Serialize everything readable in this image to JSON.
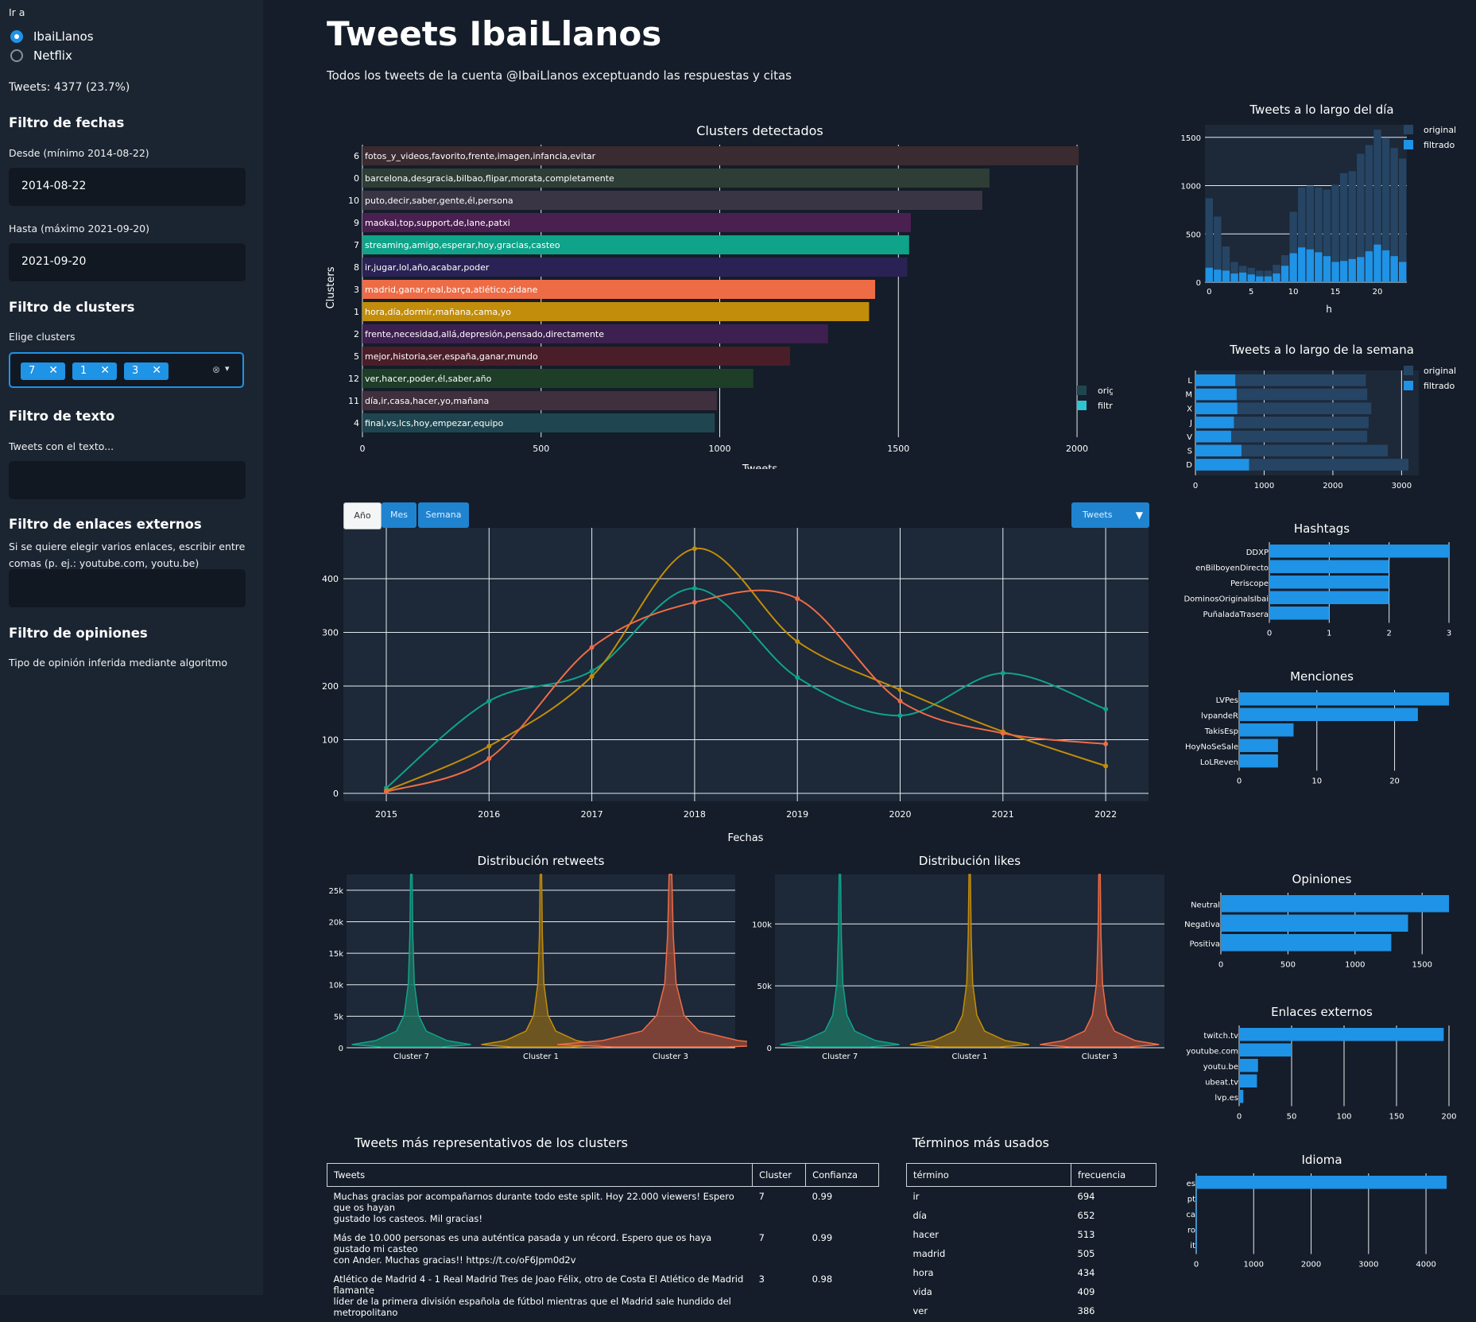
{
  "sidebar": {
    "goto_label": "Ir a",
    "options": [
      "IbaiLlanos",
      "Netflix"
    ],
    "tweets_count": "Tweets: 4377 (23.7%)",
    "date_filter": {
      "title": "Filtro de fechas",
      "from_label": "Desde (mínimo 2014-08-22)",
      "from_value": "2014-08-22",
      "to_label": "Hasta (máximo 2021-09-20)",
      "to_value": "2021-09-20"
    },
    "cluster_filter": {
      "title": "Filtro de clusters",
      "label": "Elige clusters",
      "chips": [
        "7",
        "1",
        "3"
      ]
    },
    "text_filter": {
      "title": "Filtro de texto",
      "label": "Tweets con el texto..."
    },
    "links_filter": {
      "title": "Filtro de enlaces externos",
      "desc1": "Si se quiere elegir varios enlaces, escribir entre",
      "desc2": "comas (p. ej.: youtube.com, youtu.be)"
    },
    "opinion_filter": {
      "title": "Filtro de opiniones",
      "label": "Tipo de opinión inferida mediante algoritmo"
    }
  },
  "main": {
    "title": "Tweets IbaiLlanos",
    "subtitle": "Todos los tweets de la cuenta @IbaiLlanos exceptuando las respuestas y citas"
  },
  "time_buttons": [
    "Año",
    "Mes",
    "Semana"
  ],
  "metric_dropdown": "Tweets",
  "colors": {
    "accent": "#1f93e6",
    "cluster7": "#0fa38a",
    "cluster1": "#c28d0a",
    "cluster3": "#ed6c45",
    "bg": "#141d29",
    "sidebar": "#1b2532"
  },
  "tables": {
    "tweets": {
      "title": "Tweets más representativos de los clusters",
      "headers": [
        "Tweets",
        "Cluster",
        "Confianza"
      ],
      "rows": [
        {
          "l1": "Muchas gracias por acompañarnos durante todo este split. Hoy 22.000 viewers! Espero que os hayan",
          "l2": "gustado los casteos. Mil gracias!",
          "cluster": "7",
          "conf": "0.99"
        },
        {
          "l1": "Más de 10.000 personas es una auténtica pasada y un récord. Espero que os haya gustado mi casteo",
          "l2": "con Ander. Muchas gracias!! https://t.co/oF6Jpm0d2v",
          "cluster": "7",
          "conf": "0.99"
        },
        {
          "l1": "Atlético de Madrid 4 - 1 Real Madrid   Tres de Joao Félix, otro de Costa   El Atlético de Madrid flamante",
          "l2": "líder de la primera división española de fútbol mientras que el Madrid sale hundido del metropolitano",
          "cluster": "3",
          "conf": "0.98"
        }
      ]
    },
    "terms": {
      "title": "Términos más usados",
      "headers": [
        "término",
        "frecuencia"
      ],
      "rows": [
        [
          "ir",
          "694"
        ],
        [
          "día",
          "652"
        ],
        [
          "hacer",
          "513"
        ],
        [
          "madrid",
          "505"
        ],
        [
          "hora",
          "434"
        ],
        [
          "vida",
          "409"
        ],
        [
          "ver",
          "386"
        ]
      ]
    }
  },
  "chart_data": [
    {
      "type": "bar",
      "title": "Clusters detectados",
      "xlabel": "Tweets",
      "ylabel": "Clusters",
      "orientation": "horizontal",
      "xlim": [
        0,
        2100
      ],
      "xticks": [
        0,
        500,
        1000,
        1500,
        2000
      ],
      "legend": [
        "original",
        "filtrado"
      ],
      "legend_position": "right",
      "categories": [
        {
          "id": "6",
          "label": "fotos_y_videos,favorito,frente,imagen,infancia,evitar",
          "value": 2005,
          "color": "#3a2b30",
          "filtered": false
        },
        {
          "id": "0",
          "label": "barcelona,desgracia,bilbao,flipar,morata,completamente",
          "value": 1755,
          "color": "#2e3d35",
          "filtered": false
        },
        {
          "id": "10",
          "label": "puto,decir,saber,gente,él,persona",
          "value": 1735,
          "color": "#3a3545",
          "filtered": false
        },
        {
          "id": "9",
          "label": "maokai,top,support,de,lane,patxi",
          "value": 1535,
          "color": "#4a2050",
          "filtered": false
        },
        {
          "id": "7",
          "label": "streaming,amigo,esperar,hoy,gracias,casteo",
          "value": 1530,
          "color": "#0fa38a",
          "filtered": true
        },
        {
          "id": "8",
          "label": "ir,jugar,lol,año,acabar,poder",
          "value": 1525,
          "color": "#2a2255",
          "filtered": false
        },
        {
          "id": "3",
          "label": "madrid,ganar,real,barça,atlético,zidane",
          "value": 1435,
          "color": "#ed6c45",
          "filtered": true
        },
        {
          "id": "1",
          "label": "hora,día,dormir,mañana,cama,yo",
          "value": 1418,
          "color": "#c28d0a",
          "filtered": true
        },
        {
          "id": "2",
          "label": "frente,necesidad,allá,depresión,pensado,directamente",
          "value": 1303,
          "color": "#3e2050",
          "filtered": false
        },
        {
          "id": "5",
          "label": "mejor,historia,ser,españa,ganar,mundo",
          "value": 1197,
          "color": "#4a1e28",
          "filtered": false
        },
        {
          "id": "12",
          "label": "ver,hacer,poder,él,saber,año",
          "value": 1094,
          "color": "#1e3e28",
          "filtered": false
        },
        {
          "id": "11",
          "label": "día,ir,casa,hacer,yo,mañana",
          "value": 992,
          "color": "#40303d",
          "filtered": false
        },
        {
          "id": "4",
          "label": "final,vs,lcs,hoy,empezar,equipo",
          "value": 986,
          "color": "#1f4650",
          "filtered": false
        }
      ]
    },
    {
      "type": "line",
      "xlabel": "Fechas",
      "x": [
        2015,
        2016,
        2017,
        2018,
        2019,
        2020,
        2021,
        2022
      ],
      "ylim": [
        0,
        470
      ],
      "yticks": [
        0,
        100,
        200,
        300,
        400
      ],
      "series": [
        {
          "name": "Cluster 7",
          "color": "#0fa38a",
          "values": [
            10,
            172,
            228,
            382,
            216,
            145,
            224,
            157
          ]
        },
        {
          "name": "Cluster 1",
          "color": "#c28d0a",
          "values": [
            5,
            88,
            218,
            456,
            283,
            193,
            115,
            51
          ]
        },
        {
          "name": "Cluster 3",
          "color": "#ed6c45",
          "values": [
            3,
            65,
            272,
            356,
            363,
            172,
            112,
            92
          ]
        }
      ]
    },
    {
      "type": "bar",
      "title": "Tweets a lo largo del día",
      "xlabel": "h",
      "legend": [
        "original",
        "filtrado"
      ],
      "ylim": [
        0,
        1630
      ],
      "yticks": [
        0,
        500,
        1000,
        1500
      ],
      "xticks": [
        0,
        5,
        10,
        15,
        20
      ],
      "categories": [
        0,
        1,
        2,
        3,
        4,
        5,
        6,
        7,
        8,
        9,
        10,
        11,
        12,
        13,
        14,
        15,
        16,
        17,
        18,
        19,
        20,
        21,
        22,
        23
      ],
      "series": [
        {
          "name": "original",
          "values": [
            870,
            680,
            370,
            210,
            170,
            150,
            120,
            120,
            180,
            280,
            730,
            980,
            1000,
            980,
            960,
            1010,
            1130,
            1150,
            1330,
            1420,
            1580,
            1490,
            1390,
            1280
          ]
        },
        {
          "name": "filtrado",
          "values": [
            150,
            130,
            120,
            90,
            100,
            80,
            60,
            60,
            90,
            170,
            300,
            360,
            340,
            310,
            270,
            210,
            220,
            240,
            260,
            320,
            390,
            330,
            270,
            210
          ]
        }
      ]
    },
    {
      "type": "bar",
      "title": "Tweets a lo largo de la semana",
      "orientation": "horizontal",
      "legend": [
        "original",
        "filtrado"
      ],
      "xlim": [
        0,
        3250
      ],
      "xticks": [
        0,
        1000,
        2000,
        3000
      ],
      "categories": [
        "L",
        "M",
        "X",
        "J",
        "V",
        "S",
        "D"
      ],
      "series": [
        {
          "name": "original",
          "values": [
            2480,
            2500,
            2560,
            2520,
            2500,
            2800,
            3100
          ]
        },
        {
          "name": "filtrado",
          "values": [
            580,
            600,
            610,
            560,
            520,
            670,
            780
          ]
        }
      ]
    },
    {
      "type": "bar",
      "title": "Hashtags",
      "orientation": "horizontal",
      "xlim": [
        0,
        3
      ],
      "xticks": [
        0,
        1,
        2,
        3
      ],
      "categories": [
        "DDXP",
        "enBilboyenDirecto",
        "Periscope",
        "DominosOriginalsIbai",
        "PuñaladaTrasera"
      ],
      "values": [
        3,
        2,
        2,
        2,
        1
      ]
    },
    {
      "type": "bar",
      "title": "Menciones",
      "orientation": "horizontal",
      "xlim": [
        0,
        27
      ],
      "xticks": [
        0,
        10,
        20
      ],
      "categories": [
        "LVPes",
        "lvpandeR",
        "TakisEsp",
        "HoyNoSeSale",
        "LoLReven"
      ],
      "values": [
        27,
        23,
        7,
        5,
        5
      ]
    },
    {
      "type": "bar",
      "title": "Opiniones",
      "orientation": "horizontal",
      "xlim": [
        0,
        1700
      ],
      "xticks": [
        0,
        500,
        1000,
        1500
      ],
      "categories": [
        "Neutral",
        "Negativa",
        "Positiva"
      ],
      "values": [
        1700,
        1395,
        1270
      ]
    },
    {
      "type": "bar",
      "title": "Enlaces externos",
      "orientation": "horizontal",
      "xlim": [
        0,
        200
      ],
      "xticks": [
        0,
        50,
        100,
        150,
        200
      ],
      "categories": [
        "twitch.tv",
        "youtube.com",
        "youtu.be",
        "ubeat.tv",
        "lvp.es"
      ],
      "values": [
        195,
        50,
        18,
        17,
        4
      ]
    },
    {
      "type": "bar",
      "title": "Idioma",
      "orientation": "horizontal",
      "xlim": [
        0,
        4400
      ],
      "xticks": [
        0,
        1000,
        2000,
        3000,
        4000
      ],
      "categories": [
        "es",
        "pt",
        "ca",
        "ro",
        "it"
      ],
      "values": [
        4360,
        5,
        4,
        3,
        2
      ]
    },
    {
      "type": "violin",
      "title": "Distribución retweets",
      "categories": [
        "Cluster 7",
        "Cluster 1",
        "Cluster 3"
      ],
      "ylim": [
        0,
        27500
      ],
      "yticks": [
        0,
        5000,
        10000,
        15000,
        20000,
        25000
      ],
      "ytick_labels": [
        "0",
        "5k",
        "10k",
        "15k",
        "20k",
        "25k"
      ]
    },
    {
      "type": "violin",
      "title": "Distribución likes",
      "categories": [
        "Cluster 7",
        "Cluster 1",
        "Cluster 3"
      ],
      "ylim": [
        0,
        140000
      ],
      "yticks": [
        0,
        50000,
        100000
      ],
      "ytick_labels": [
        "0",
        "50k",
        "100k"
      ]
    }
  ]
}
